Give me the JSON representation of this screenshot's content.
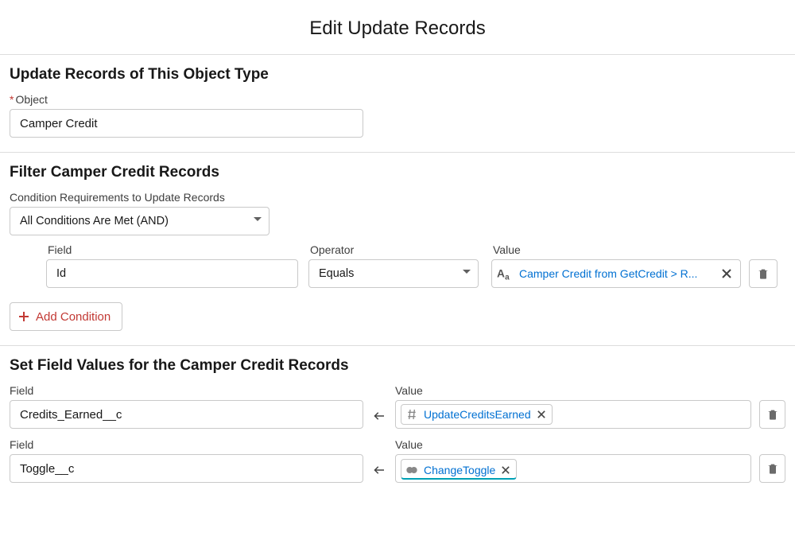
{
  "title": "Edit Update Records",
  "section1": {
    "heading": "Update Records of This Object Type",
    "object_label": "Object",
    "object_value": "Camper Credit"
  },
  "section2": {
    "heading": "Filter Camper Credit Records",
    "cond_req_label": "Condition Requirements to Update Records",
    "cond_req_value": "All Conditions Are Met (AND)",
    "col_field": "Field",
    "col_operator": "Operator",
    "col_value": "Value",
    "row1_field": "Id",
    "row1_operator": "Equals",
    "row1_value": "Camper Credit from GetCredit > R...",
    "add_condition": "Add Condition"
  },
  "section3": {
    "heading": "Set Field Values for the Camper Credit Records",
    "field_label": "Field",
    "value_label": "Value",
    "rows": [
      {
        "field": "Credits_Earned__c",
        "value": "UpdateCreditsEarned",
        "icon": "hash"
      },
      {
        "field": "Toggle__c",
        "value": "ChangeToggle",
        "icon": "toggle"
      }
    ]
  }
}
